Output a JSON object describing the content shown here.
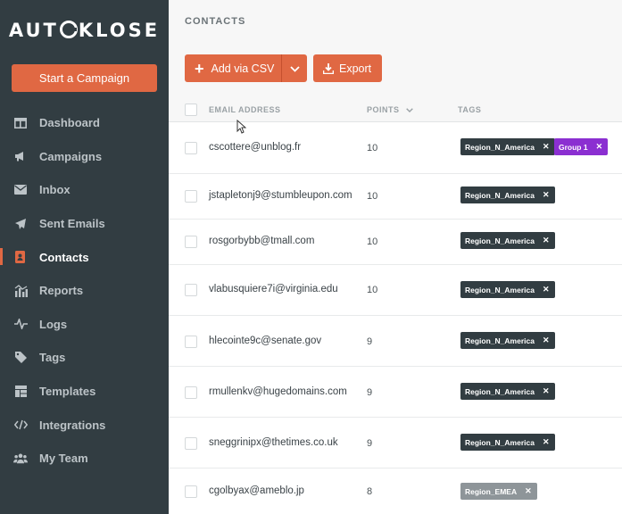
{
  "app": {
    "logo": "AUTOKLOSE",
    "logo_left": "AUT",
    "logo_right": "KLOSE",
    "cta_label": "Start a Campaign"
  },
  "sidebar": {
    "items": [
      {
        "label": "Dashboard",
        "icon": "dashboard-icon"
      },
      {
        "label": "Campaigns",
        "icon": "megaphone-icon"
      },
      {
        "label": "Inbox",
        "icon": "envelope-icon"
      },
      {
        "label": "Sent Emails",
        "icon": "paper-plane-icon"
      },
      {
        "label": "Contacts",
        "icon": "contact-book-icon",
        "active": true
      },
      {
        "label": "Reports",
        "icon": "bar-chart-icon"
      },
      {
        "label": "Logs",
        "icon": "pulse-icon"
      },
      {
        "label": "Tags",
        "icon": "tag-icon"
      },
      {
        "label": "Templates",
        "icon": "template-icon"
      },
      {
        "label": "Integrations",
        "icon": "code-icon"
      },
      {
        "label": "My Team",
        "icon": "team-icon"
      }
    ]
  },
  "main": {
    "title": "CONTACTS",
    "add_label": "Add via CSV",
    "export_label": "Export",
    "columns": {
      "email": "EMAIL ADDRESS",
      "points": "POINTS",
      "tags": "TAGS"
    }
  },
  "rows": [
    {
      "email": "cscottere@unblog.fr",
      "points": "10",
      "tags": [
        {
          "label": "Region_N_America",
          "style": "dark"
        },
        {
          "label": "Group 1",
          "style": "purple"
        }
      ]
    },
    {
      "email": "jstapletonj9@stumbleupon.com",
      "points": "10",
      "tags": [
        {
          "label": "Region_N_America",
          "style": "dark"
        }
      ]
    },
    {
      "email": "rosgorbybb@tmall.com",
      "points": "10",
      "tags": [
        {
          "label": "Region_N_America",
          "style": "dark"
        }
      ]
    },
    {
      "email": "vlabusquiere7i@virginia.edu",
      "points": "10",
      "tags": [
        {
          "label": "Region_N_America",
          "style": "dark"
        }
      ]
    },
    {
      "email": "hlecointe9c@senate.gov",
      "points": "9",
      "tags": [
        {
          "label": "Region_N_America",
          "style": "dark"
        }
      ]
    },
    {
      "email": "rmullenkv@hugedomains.com",
      "points": "9",
      "tags": [
        {
          "label": "Region_N_America",
          "style": "dark"
        }
      ]
    },
    {
      "email": "sneggrinipx@thetimes.co.uk",
      "points": "9",
      "tags": [
        {
          "label": "Region_N_America",
          "style": "dark"
        }
      ]
    },
    {
      "email": "cgolbyax@ameblo.jp",
      "points": "8",
      "tags": [
        {
          "label": "Region_EMEA",
          "style": "gray"
        }
      ]
    }
  ],
  "colors": {
    "accent": "#e06843",
    "sidebar": "#323d42",
    "tag_dark": "#323d42",
    "tag_purple": "#8b2fd1",
    "tag_gray": "#8e9599"
  }
}
